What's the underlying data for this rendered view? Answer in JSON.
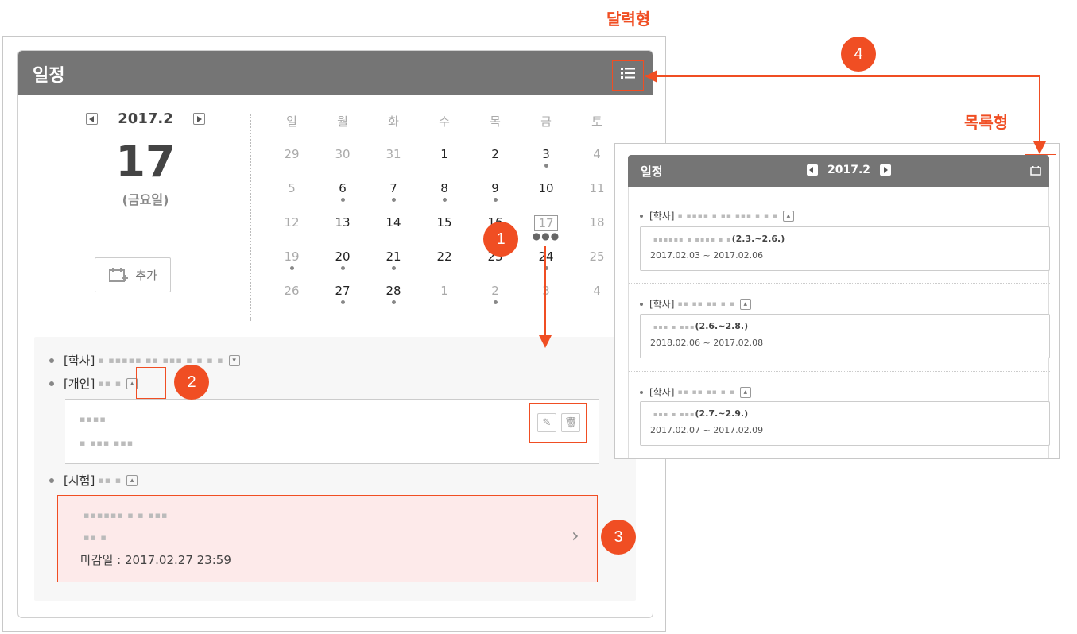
{
  "annotations": {
    "calendar_title": "달력형",
    "list_title": "목록형",
    "badges": [
      "1",
      "2",
      "3",
      "4"
    ]
  },
  "calendar_widget": {
    "title": "일정",
    "list_toggle_icon": "list-icon",
    "month": "2017.2",
    "selected_day": "17",
    "selected_weekday": "(금요일)",
    "add_label": "추가",
    "weekdays": [
      "일",
      "월",
      "화",
      "수",
      "목",
      "금",
      "토"
    ],
    "weeks": [
      [
        "29",
        "30",
        "31",
        "1",
        "2",
        "3",
        "4"
      ],
      [
        "5",
        "6",
        "7",
        "8",
        "9",
        "10",
        "11"
      ],
      [
        "12",
        "13",
        "14",
        "15",
        "16",
        "17",
        "18"
      ],
      [
        "19",
        "20",
        "21",
        "22",
        "23",
        "24",
        "25"
      ],
      [
        "26",
        "27",
        "28",
        "1",
        "2",
        "3",
        "4"
      ]
    ],
    "events": [
      {
        "tag": "[학사]"
      },
      {
        "tag": "[개인]"
      },
      {
        "tag": "[시험]"
      }
    ],
    "deadline_label": "마감일 : 2017.02.27 23:59"
  },
  "list_widget": {
    "title": "일정",
    "month": "2017.2",
    "calendar_toggle_icon": "calendar-icon",
    "items": [
      {
        "tag": "[학사]",
        "title_suffix": "(2.3.~2.6.)",
        "range": "2017.02.03 ~ 2017.02.06"
      },
      {
        "tag": "[학사]",
        "title_suffix": "(2.6.~2.8.)",
        "range": "2018.02.06 ~ 2017.02.08"
      },
      {
        "tag": "[학사]",
        "title_suffix": "(2.7.~2.9.)",
        "range": "2017.02.07 ~ 2017.02.09"
      }
    ]
  },
  "colors": {
    "accent": "#f04e23",
    "header": "#757575"
  }
}
